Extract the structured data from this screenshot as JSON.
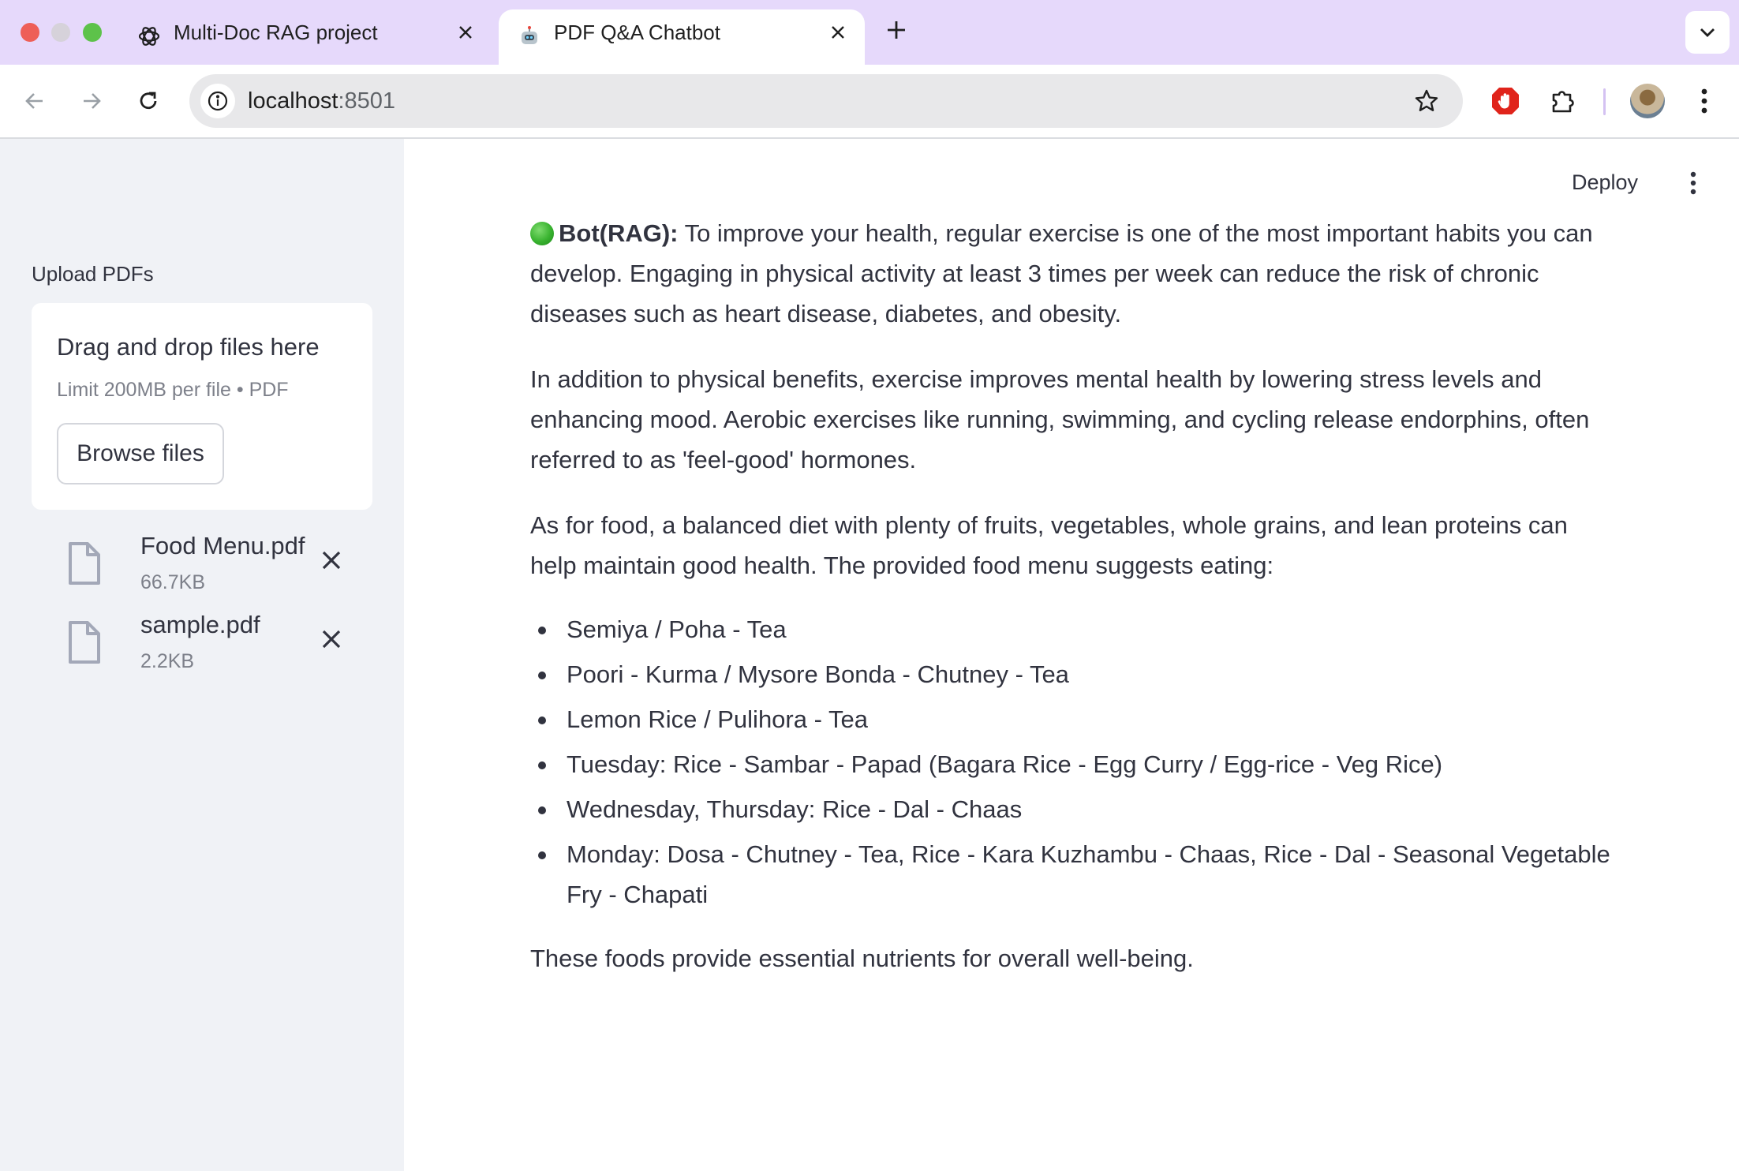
{
  "browser": {
    "tabs": [
      {
        "title": "Multi-Doc RAG project",
        "icon": "openai-logo-icon",
        "active": false
      },
      {
        "title": "PDF Q&A Chatbot",
        "icon": "robot-icon",
        "active": true
      }
    ],
    "url_host": "localhost",
    "url_port": ":8501",
    "colors": {
      "tabbar": "#e6d9fb",
      "omnibox": "#e8e8ea",
      "extension_red": "#e0241b"
    }
  },
  "sidebar": {
    "upload_label": "Upload PDFs",
    "dropzone": {
      "title": "Drag and drop files here",
      "limit": "Limit 200MB per file • PDF",
      "browse_label": "Browse files"
    },
    "files": [
      {
        "name": "Food Menu.pdf",
        "size": "66.7KB"
      },
      {
        "name": "sample.pdf",
        "size": "2.2KB"
      }
    ]
  },
  "header": {
    "deploy_label": "Deploy"
  },
  "chat": {
    "bot_label": "Bot(RAG):",
    "paragraph1": "To improve your health, regular exercise is one of the most important habits you can develop. Engaging in physical activity at least 3 times per week can reduce the risk of chronic diseases such as heart disease, diabetes, and obesity.",
    "paragraph2": "In addition to physical benefits, exercise improves mental health by lowering stress levels and enhancing mood. Aerobic exercises like running, swimming, and cycling release endorphins, often referred to as 'feel-good' hormones.",
    "paragraph3": "As for food, a balanced diet with plenty of fruits, vegetables, whole grains, and lean proteins can help maintain good health. The provided food menu suggests eating:",
    "menu_items": [
      "Semiya / Poha - Tea",
      "Poori - Kurma / Mysore Bonda - Chutney - Tea",
      "Lemon Rice / Pulihora - Tea",
      "Tuesday: Rice - Sambar - Papad (Bagara Rice - Egg Curry / Egg-rice - Veg Rice)",
      "Wednesday, Thursday: Rice - Dal - Chaas",
      "Monday: Dosa - Chutney - Tea, Rice - Kara Kuzhambu - Chaas, Rice - Dal - Seasonal Vegetable Fry - Chapati"
    ],
    "closing": "These foods provide essential nutrients for overall well-being."
  }
}
